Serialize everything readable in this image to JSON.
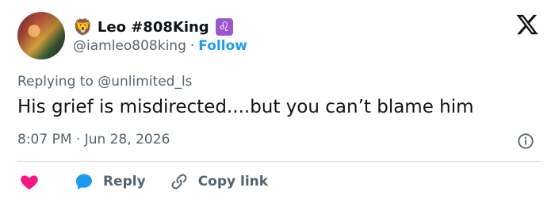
{
  "author": {
    "emoji": "🦁",
    "display_name": "Leo #808King",
    "zodiac_badge": "♌",
    "handle": "@iamleo808king",
    "separator": "·",
    "follow_label": "Follow"
  },
  "reply_context": {
    "prefix": "Replying to",
    "target": "@unlimited_ls"
  },
  "tweet": {
    "text": "His grief is misdirected....but you can’t blame him",
    "timestamp": "8:07 PM · Jun 28, 2026"
  },
  "actions": {
    "reply_label": "Reply",
    "copy_link_label": "Copy link"
  },
  "colors": {
    "accent": "#1d9bf0",
    "like": "#f91880",
    "muted": "#536471",
    "zodiac": "#9b59d0"
  },
  "icons": [
    "x-logo-icon",
    "info-icon",
    "heart-icon",
    "reply-bubble-icon",
    "link-icon"
  ]
}
